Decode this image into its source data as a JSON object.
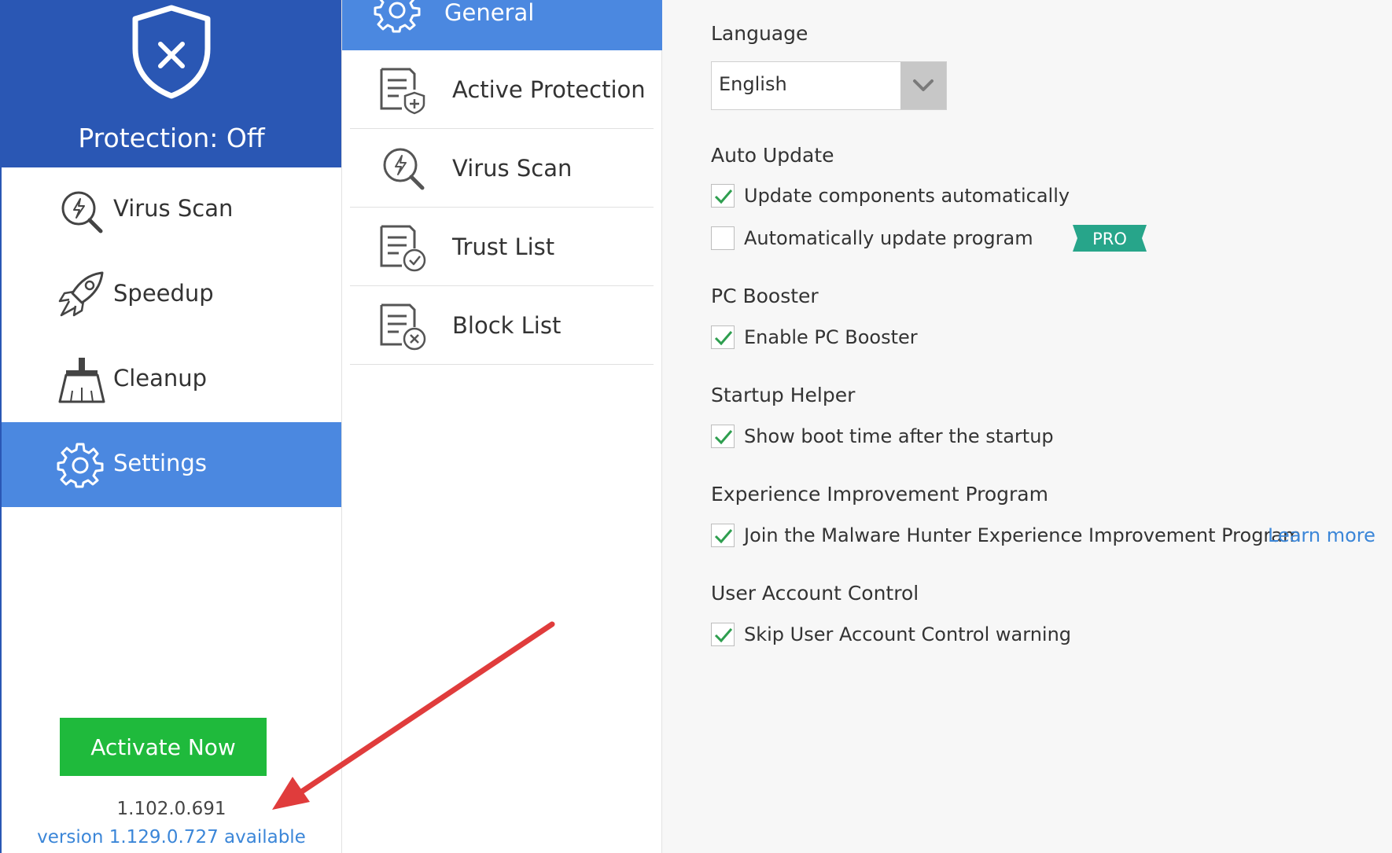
{
  "sidebar": {
    "protection_status": "Protection: Off",
    "items": [
      {
        "label": "Virus Scan",
        "icon": "virus-scan-icon"
      },
      {
        "label": "Speedup",
        "icon": "rocket-icon"
      },
      {
        "label": "Cleanup",
        "icon": "broom-icon"
      },
      {
        "label": "Settings",
        "icon": "gear-icon",
        "active": true
      }
    ],
    "activate_label": "Activate Now",
    "current_version": "1.102.0.691",
    "update_available": "version 1.129.0.727 available"
  },
  "settings_nav": {
    "items": [
      {
        "label": "General",
        "icon": "gear-icon",
        "active": true
      },
      {
        "label": "Active Protection",
        "icon": "shield-document-icon"
      },
      {
        "label": "Virus Scan",
        "icon": "virus-scan-icon"
      },
      {
        "label": "Trust List",
        "icon": "trust-list-icon"
      },
      {
        "label": "Block List",
        "icon": "block-list-icon"
      }
    ]
  },
  "general": {
    "language": {
      "title": "Language",
      "selected": "English"
    },
    "auto_update": {
      "title": "Auto Update",
      "options": [
        {
          "label": "Update components automatically",
          "checked": true
        },
        {
          "label": "Automatically update program",
          "checked": false,
          "badge": "PRO"
        }
      ]
    },
    "pc_booster": {
      "title": "PC Booster",
      "options": [
        {
          "label": "Enable PC Booster",
          "checked": true
        }
      ]
    },
    "startup_helper": {
      "title": "Startup Helper",
      "options": [
        {
          "label": "Show boot time after the startup",
          "checked": true
        }
      ]
    },
    "experience": {
      "title": "Experience Improvement Program",
      "options": [
        {
          "label": "Join the Malware Hunter Experience Improvement Program",
          "checked": true
        }
      ],
      "link": "Learn more"
    },
    "uac": {
      "title": "User Account Control",
      "options": [
        {
          "label": "Skip User Account Control warning",
          "checked": true
        }
      ]
    }
  },
  "colors": {
    "sidebar_header": "#2a57b4",
    "active_item": "#4b88e0",
    "activate_button": "#1fba3c",
    "link": "#3b86d8",
    "pro_badge": "#27a58a",
    "checkmark": "#2e9e4f",
    "annotation_arrow": "#e03c3c"
  }
}
